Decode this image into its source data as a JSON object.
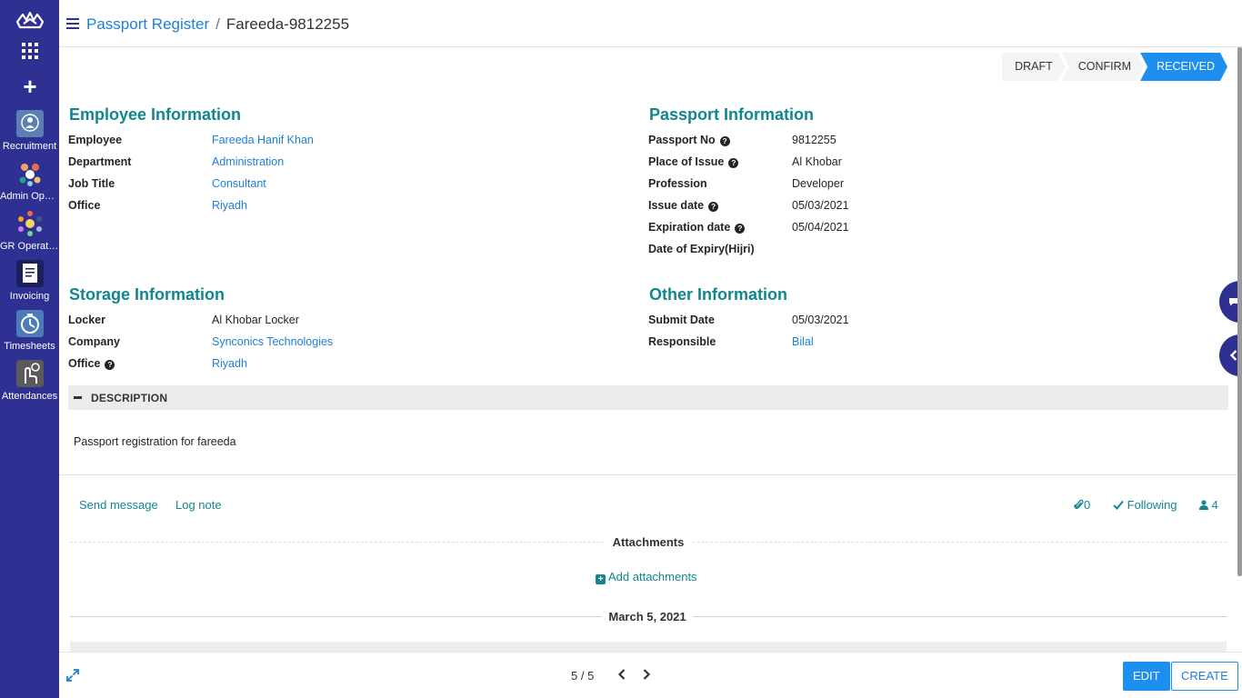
{
  "sidebar": {
    "apps": [
      {
        "label": "Recruitment",
        "icon": "recruitment-icon"
      },
      {
        "label": "Admin Operations",
        "icon": "admin-operations-icon"
      },
      {
        "label": "GR Operations",
        "icon": "gr-operations-icon"
      },
      {
        "label": "Invoicing",
        "icon": "invoicing-icon"
      },
      {
        "label": "Timesheets",
        "icon": "timesheets-icon"
      },
      {
        "label": "Attendances",
        "icon": "attendances-icon"
      }
    ]
  },
  "breadcrumb": {
    "parent": "Passport Register",
    "separator": "/",
    "current": "Fareeda-9812255"
  },
  "status": {
    "stages": [
      "DRAFT",
      "CONFIRM",
      "RECEIVED"
    ],
    "active": "RECEIVED"
  },
  "employee": {
    "title": "Employee Information",
    "fields": [
      {
        "label": "Employee",
        "value": "Fareeda Hanif Khan"
      },
      {
        "label": "Department",
        "value": "Administration"
      },
      {
        "label": "Job Title",
        "value": "Consultant"
      },
      {
        "label": "Office",
        "value": "Riyadh"
      }
    ]
  },
  "passport": {
    "title": "Passport Information",
    "fields": [
      {
        "label": "Passport No",
        "value": "9812255"
      },
      {
        "label": "Place of Issue",
        "value": "Al Khobar"
      },
      {
        "label": "Profession",
        "value": "Developer"
      },
      {
        "label": "Issue date",
        "value": "05/03/2021"
      },
      {
        "label": "Expiration date",
        "value": "05/04/2021"
      },
      {
        "label": "Date of Expiry(Hijri)",
        "value": ""
      }
    ]
  },
  "storage": {
    "title": "Storage Information",
    "fields": [
      {
        "label": "Locker",
        "value": "Al Khobar Locker"
      },
      {
        "label": "Company",
        "value": "Synconics Technologies"
      },
      {
        "label": "Office",
        "value": "Riyadh"
      }
    ]
  },
  "other": {
    "title": "Other Information",
    "fields": [
      {
        "label": "Submit Date",
        "value": "05/03/2021"
      },
      {
        "label": "Responsible",
        "value": "Bilal"
      }
    ]
  },
  "description": {
    "label": "DESCRIPTION",
    "text": "Passport registration for fareeda"
  },
  "chatter": {
    "send_message": "Send message",
    "log_note": "Log note",
    "attachment_count": "0",
    "following": "Following",
    "followers_count": "4",
    "attachments_title": "Attachments",
    "add_attachments": "Add attachments",
    "date_separator": "March 5, 2021"
  },
  "pager": {
    "text": "5 / 5"
  },
  "actions": {
    "edit": "EDIT",
    "create": "CREATE"
  },
  "colors": {
    "sidebar": "#2e3192",
    "accent": "#1d8ff0",
    "section_title": "#12868f",
    "link": "#1d7fd8"
  }
}
